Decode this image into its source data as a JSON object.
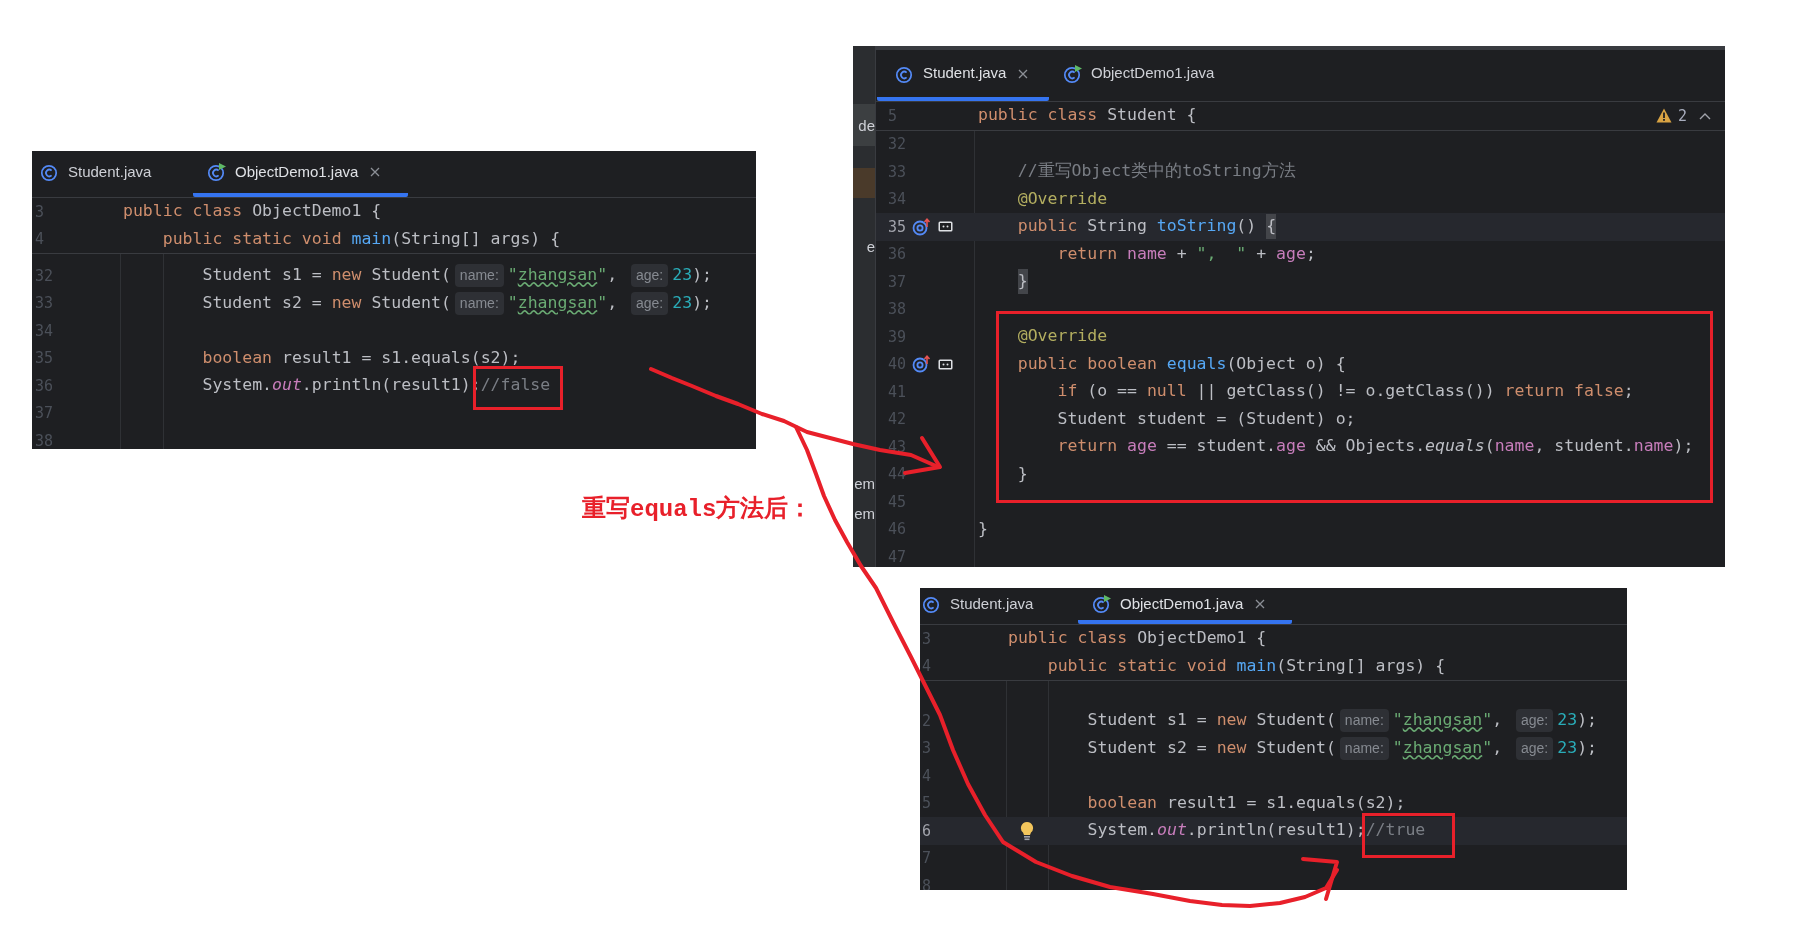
{
  "annotation": {
    "text": "重写equals方法后："
  },
  "panels": [
    {
      "tabs": [
        {
          "label": "Student.java",
          "kind": "class",
          "selected": false,
          "closable": false
        },
        {
          "label": "ObjectDemo1.java",
          "kind": "runnable",
          "selected": true,
          "closable": true
        }
      ],
      "sticky_lines": [
        {
          "number": "3",
          "kind": "plain",
          "current": false,
          "tokens": [
            {
              "kind": "keyword",
              "text": "public class "
            },
            {
              "kind": "plain",
              "text": "ObjectDemo1 {"
            }
          ]
        },
        {
          "number": "4",
          "kind": "plain",
          "current": false,
          "tokens": [
            {
              "kind": "keyword",
              "text": "    public static void "
            },
            {
              "kind": "method",
              "text": "main"
            },
            {
              "kind": "plain",
              "text": "(String[] args) {"
            }
          ]
        }
      ],
      "lines": [
        {
          "number": "32",
          "kind": "plain",
          "current": false,
          "tokens": [
            {
              "kind": "plain",
              "text": "        Student s1 = "
            },
            {
              "kind": "keyword",
              "text": "new "
            },
            {
              "kind": "plain",
              "text": "Student("
            },
            {
              "kind": "hint",
              "text": "name:"
            },
            {
              "kind": "string",
              "text": "\""
            },
            {
              "kind": "typo",
              "text": "zhangsan"
            },
            {
              "kind": "string",
              "text": "\""
            },
            {
              "kind": "plain",
              "text": ", "
            },
            {
              "kind": "hint",
              "text": "age:"
            },
            {
              "kind": "number",
              "text": "23"
            },
            {
              "kind": "plain",
              "text": ");"
            }
          ]
        },
        {
          "number": "33",
          "kind": "plain",
          "current": false,
          "tokens": [
            {
              "kind": "plain",
              "text": "        Student s2 = "
            },
            {
              "kind": "keyword",
              "text": "new "
            },
            {
              "kind": "plain",
              "text": "Student("
            },
            {
              "kind": "hint",
              "text": "name:"
            },
            {
              "kind": "string",
              "text": "\""
            },
            {
              "kind": "typo",
              "text": "zhangsan"
            },
            {
              "kind": "string",
              "text": "\""
            },
            {
              "kind": "plain",
              "text": ", "
            },
            {
              "kind": "hint",
              "text": "age:"
            },
            {
              "kind": "number",
              "text": "23"
            },
            {
              "kind": "plain",
              "text": ");"
            }
          ]
        },
        {
          "number": "34",
          "kind": "plain",
          "current": false
        },
        {
          "number": "35",
          "kind": "plain",
          "current": false,
          "tokens": [
            {
              "kind": "keyword",
              "text": "        boolean "
            },
            {
              "kind": "plain",
              "text": "result1 = s1.equals(s2);"
            }
          ]
        },
        {
          "number": "36",
          "kind": "plain",
          "current": false,
          "tokens": [
            {
              "kind": "plain",
              "text": "        System."
            },
            {
              "kind": "static-field",
              "text": "out"
            },
            {
              "kind": "plain",
              "text": ".println(result1);"
            },
            {
              "kind": "comment",
              "text": "//false"
            }
          ]
        },
        {
          "number": "37",
          "kind": "plain",
          "current": false
        },
        {
          "number": "38",
          "kind": "plain",
          "current": false
        }
      ]
    },
    {
      "sidebar": [
        "de",
        "e",
        "em",
        "em"
      ],
      "problems": {
        "count": "2"
      },
      "tabs": [
        {
          "label": "Student.java",
          "kind": "class",
          "selected": true,
          "closable": true
        },
        {
          "label": "ObjectDemo1.java",
          "kind": "runnable",
          "selected": false,
          "closable": false
        }
      ],
      "sticky_lines": [
        {
          "number": "5",
          "kind": "plain",
          "current": false,
          "tokens": [
            {
              "kind": "keyword",
              "text": "public class "
            },
            {
              "kind": "plain",
              "text": "Student {"
            }
          ]
        }
      ],
      "lines": [
        {
          "number": "32",
          "kind": "plain",
          "current": false
        },
        {
          "number": "33",
          "kind": "plain",
          "current": false,
          "tokens": [
            {
              "kind": "comment",
              "text": "    //重写Object类中的toString方法"
            }
          ]
        },
        {
          "number": "34",
          "kind": "plain",
          "current": false,
          "tokens": [
            {
              "kind": "annotation",
              "text": "    @Override"
            }
          ]
        },
        {
          "number": "35",
          "kind": "override",
          "current": true,
          "tokens": [
            {
              "kind": "keyword",
              "text": "    public "
            },
            {
              "kind": "plain",
              "text": "String "
            },
            {
              "kind": "method",
              "text": "toString"
            },
            {
              "kind": "plain",
              "text": "() "
            },
            {
              "kind": "brace",
              "text": "{"
            }
          ]
        },
        {
          "number": "36",
          "kind": "plain",
          "current": false,
          "tokens": [
            {
              "kind": "keyword",
              "text": "        return "
            },
            {
              "kind": "field",
              "text": "name"
            },
            {
              "kind": "plain",
              "text": " + "
            },
            {
              "kind": "string",
              "text": "\",  \""
            },
            {
              "kind": "plain",
              "text": " + "
            },
            {
              "kind": "field",
              "text": "age"
            },
            {
              "kind": "plain",
              "text": ";"
            }
          ]
        },
        {
          "number": "37",
          "kind": "plain",
          "current": false,
          "tokens": [
            {
              "kind": "brace",
              "text": "    }"
            }
          ]
        },
        {
          "number": "38",
          "kind": "plain",
          "current": false
        },
        {
          "number": "39",
          "kind": "plain",
          "current": false,
          "tokens": [
            {
              "kind": "annotation",
              "text": "    @Override"
            }
          ]
        },
        {
          "number": "40",
          "kind": "override",
          "current": false,
          "tokens": [
            {
              "kind": "keyword",
              "text": "    public boolean "
            },
            {
              "kind": "method",
              "text": "equals"
            },
            {
              "kind": "plain",
              "text": "(Object o) {"
            }
          ]
        },
        {
          "number": "41",
          "kind": "plain",
          "current": false,
          "tokens": [
            {
              "kind": "keyword",
              "text": "        if "
            },
            {
              "kind": "plain",
              "text": "(o == "
            },
            {
              "kind": "keyword",
              "text": "null"
            },
            {
              "kind": "plain",
              "text": " || getClass() != o.getClass()) "
            },
            {
              "kind": "keyword",
              "text": "return false"
            },
            {
              "kind": "plain",
              "text": ";"
            }
          ]
        },
        {
          "number": "42",
          "kind": "plain",
          "current": false,
          "tokens": [
            {
              "kind": "plain",
              "text": "        Student student = (Student) o;"
            }
          ]
        },
        {
          "number": "43",
          "kind": "plain",
          "current": false,
          "tokens": [
            {
              "kind": "keyword",
              "text": "        return "
            },
            {
              "kind": "field",
              "text": "age"
            },
            {
              "kind": "plain",
              "text": " == student."
            },
            {
              "kind": "field",
              "text": "age"
            },
            {
              "kind": "plain",
              "text": " && Objects."
            },
            {
              "kind": "static-call",
              "text": "equals"
            },
            {
              "kind": "plain",
              "text": "("
            },
            {
              "kind": "field",
              "text": "name"
            },
            {
              "kind": "plain",
              "text": ", student."
            },
            {
              "kind": "field",
              "text": "name"
            },
            {
              "kind": "plain",
              "text": ");"
            }
          ]
        },
        {
          "number": "44",
          "kind": "plain",
          "current": false,
          "tokens": [
            {
              "kind": "plain",
              "text": "    }"
            }
          ]
        },
        {
          "number": "45",
          "kind": "plain",
          "current": false
        },
        {
          "number": "46",
          "kind": "plain",
          "current": false,
          "tokens": [
            {
              "kind": "plain",
              "text": "}"
            }
          ]
        },
        {
          "number": "47",
          "kind": "plain",
          "current": false
        }
      ]
    },
    {
      "tabs": [
        {
          "label": "Student.java",
          "kind": "class",
          "selected": false,
          "closable": false
        },
        {
          "label": "ObjectDemo1.java",
          "kind": "runnable",
          "selected": true,
          "closable": true
        }
      ],
      "sticky_lines": [
        {
          "number": "3",
          "kind": "plain",
          "current": false,
          "tokens": [
            {
              "kind": "keyword",
              "text": "public class "
            },
            {
              "kind": "plain",
              "text": "ObjectDemo1 {"
            }
          ]
        },
        {
          "number": "4",
          "kind": "plain",
          "current": false,
          "tokens": [
            {
              "kind": "keyword",
              "text": "    public static void "
            },
            {
              "kind": "method",
              "text": "main"
            },
            {
              "kind": "plain",
              "text": "(String[] args) {"
            }
          ]
        }
      ],
      "lines": [
        {
          "number": "2",
          "kind": "plain",
          "current": false,
          "tokens": [
            {
              "kind": "plain",
              "text": "        Student s1 = "
            },
            {
              "kind": "keyword",
              "text": "new "
            },
            {
              "kind": "plain",
              "text": "Student("
            },
            {
              "kind": "hint",
              "text": "name:"
            },
            {
              "kind": "string",
              "text": "\""
            },
            {
              "kind": "typo",
              "text": "zhangsan"
            },
            {
              "kind": "string",
              "text": "\""
            },
            {
              "kind": "plain",
              "text": ", "
            },
            {
              "kind": "hint",
              "text": "age:"
            },
            {
              "kind": "number",
              "text": "23"
            },
            {
              "kind": "plain",
              "text": ");"
            }
          ]
        },
        {
          "number": "3",
          "kind": "plain",
          "current": false,
          "tokens": [
            {
              "kind": "plain",
              "text": "        Student s2 = "
            },
            {
              "kind": "keyword",
              "text": "new "
            },
            {
              "kind": "plain",
              "text": "Student("
            },
            {
              "kind": "hint",
              "text": "name:"
            },
            {
              "kind": "string",
              "text": "\""
            },
            {
              "kind": "typo",
              "text": "zhangsan"
            },
            {
              "kind": "string",
              "text": "\""
            },
            {
              "kind": "plain",
              "text": ", "
            },
            {
              "kind": "hint",
              "text": "age:"
            },
            {
              "kind": "number",
              "text": "23"
            },
            {
              "kind": "plain",
              "text": ");"
            }
          ]
        },
        {
          "number": "4",
          "kind": "plain",
          "current": false
        },
        {
          "number": "5",
          "kind": "plain",
          "current": false,
          "tokens": [
            {
              "kind": "keyword",
              "text": "        boolean "
            },
            {
              "kind": "plain",
              "text": "result1 = s1.equals(s2);"
            }
          ]
        },
        {
          "number": "6",
          "kind": "bulb",
          "current": true,
          "tokens": [
            {
              "kind": "plain",
              "text": "        System."
            },
            {
              "kind": "static-field",
              "text": "out"
            },
            {
              "kind": "plain",
              "text": ".println(result1);"
            },
            {
              "kind": "comment",
              "text": "//true"
            }
          ]
        },
        {
          "number": "7",
          "kind": "plain",
          "current": false
        },
        {
          "number": "8",
          "kind": "plain",
          "current": false
        }
      ]
    }
  ]
}
